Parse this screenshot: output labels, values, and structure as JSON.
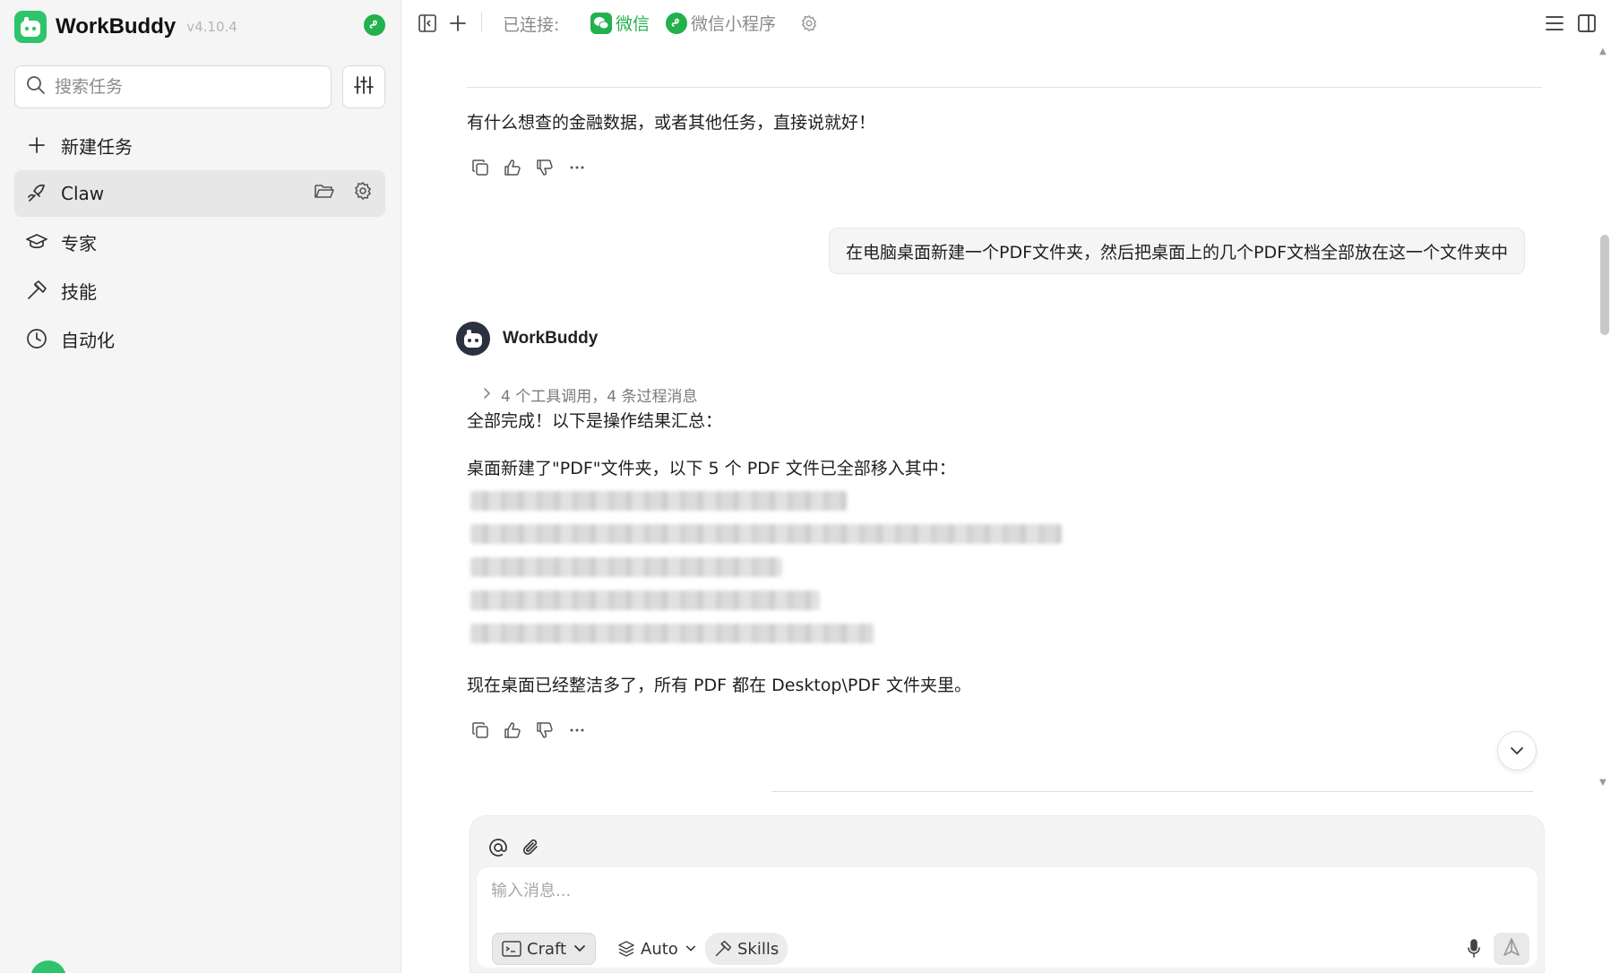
{
  "sidebar": {
    "brand_name": "WorkBuddy",
    "version": "v4.10.4",
    "search_placeholder": "搜索任务",
    "items": [
      {
        "label": "新建任务",
        "icon": "plus-icon"
      },
      {
        "label": "Claw",
        "icon": "claw-icon",
        "active": true
      },
      {
        "label": "专家",
        "icon": "graduation-cap-icon"
      },
      {
        "label": "技能",
        "icon": "tool-hammer-icon"
      },
      {
        "label": "自动化",
        "icon": "clock-icon"
      }
    ]
  },
  "topbar": {
    "connected_label": "已连接:",
    "connections": [
      {
        "label": "微信",
        "icon": "wechat-icon",
        "color": "#22b14c"
      },
      {
        "label": "微信小程序",
        "icon": "miniprogram-icon",
        "color": "#22b14c"
      }
    ]
  },
  "chat": {
    "prev_reply": "有什么想查的金融数据，或者其他任务，直接说就好！",
    "user_message": "在电脑桌面新建一个PDF文件夹，然后把桌面上的几个PDF文档全部放在这一个文件夹中",
    "bot_name": "WorkBuddy",
    "tool_summary": "4 个工具调用，4 条过程消息",
    "reply_line1": "全部完成！以下是操作结果汇总：",
    "reply_line2": "桌面新建了\"PDF\"文件夹，以下 5 个 PDF 文件已全部移入其中：",
    "reply_line3": "现在桌面已经整洁多了，所有 PDF 都在 Desktop\\PDF 文件夹里。"
  },
  "composer": {
    "placeholder": "输入消息...",
    "mode_label": "Craft",
    "model_label": "Auto",
    "skills_label": "Skills"
  },
  "colors": {
    "accent_green": "#22b14c",
    "sidebar_bg": "#f5f5f5",
    "active_item_bg": "#e7e7e7"
  }
}
